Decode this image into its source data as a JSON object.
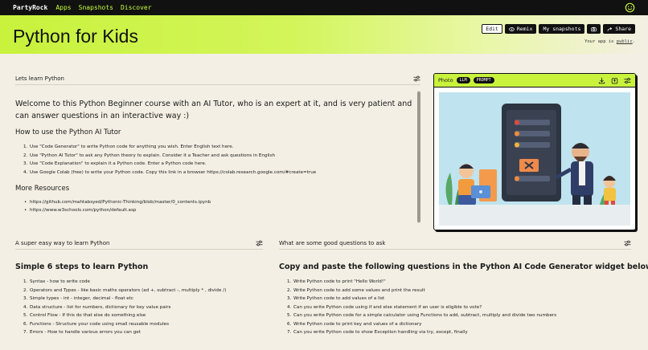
{
  "nav": {
    "brand": "PartyRock",
    "links": [
      "Apps",
      "Snapshots",
      "Discover"
    ]
  },
  "hero": {
    "title": "Python for Kids",
    "buttons": {
      "edit": "Edit",
      "remix": "Remix",
      "snapshots": "My snapshots",
      "share": "Share"
    },
    "public_prefix": "Your app is ",
    "public_link": "public",
    "public_suffix": "."
  },
  "panel_learn": {
    "title": "Lets learn Python",
    "intro": "Welcome to this Python Beginner course with an AI Tutor, who is an expert at it, and is very patient and can answer questions in an interactive way :)",
    "howto_heading": "How to use the Python AI Tutor",
    "steps": [
      "Use \"Code Generator\" to write Python code for anything you wish. Enter English text here.",
      "Use \"Python AI Tutor\" to ask any Python theory to explain. Consider it a Teacher and ask questions in English",
      "Use \"Code Explanation\" to explain it a Python code. Enter a Python code here.",
      "Use Google Colab (free) to write your Python code. Copy this link in a browser https://colab.research.google.com/#create=true"
    ],
    "resources_heading": "More Resources",
    "resources": [
      "https://github.com/mahtabsyed/Pythonic-Thinking/blob/master/0_contents.ipynb",
      "https://www.w3schools.com/python/default.asp"
    ]
  },
  "panel_photo": {
    "title": "Photo",
    "tags": [
      "LLM",
      "PROMPT"
    ]
  },
  "panel_easy": {
    "title": "A super easy way to learn Python",
    "heading": "Simple 6 steps to learn Python",
    "items": [
      "Syntax - how to write code",
      "Operators and Types - like basic maths operators (ad +, subtract -, multiply * , divide /)",
      "Simple types - int - integer, decimal - float etc",
      "Data structure - list for numbers, dictionary for key value pairs",
      "Control Flow - If this do that else do something else",
      "Functions - Structure your code using small reusable modules",
      "Errors - How to handle various errors you can get"
    ]
  },
  "panel_questions": {
    "title": "What are some good questions to ask",
    "heading": "Copy and paste the following questions in the Python AI Code Generator widget below?",
    "items": [
      "Write Python code to print \"Hello World!\"",
      "Write Python code to add some values and print the result",
      "Write Python code to add values of a list",
      "Can you write Python code using if and else statement if an user is eligible to vote?",
      "Can you write Python code for a simple calculator using Functions to add, subtract, multiply and divide two numbers",
      "Write Python code to print key and values of a dictionary",
      "Can you write Python code to show Exception handling via try, except, finally"
    ]
  },
  "colors": {
    "accent": "#c8f23c",
    "topbar": "#111111",
    "background": "#f3efe4"
  }
}
